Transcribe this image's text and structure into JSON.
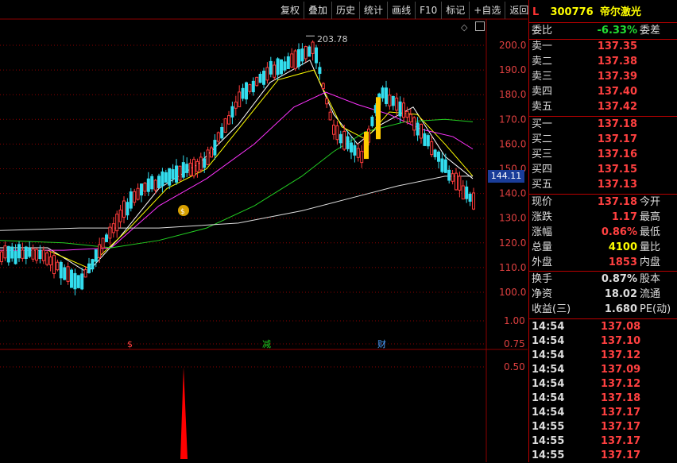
{
  "toolbar": [
    "复权",
    "叠加",
    "历史",
    "统计",
    "画线",
    "F10",
    "标记",
    "+自选",
    "返回"
  ],
  "header": {
    "level": "L",
    "code": "300776",
    "name": "帝尔激光"
  },
  "weibi": {
    "label": "委比",
    "value": "-6.33%",
    "label2": "委差"
  },
  "sell": [
    {
      "label": "卖五",
      "price": "137.42"
    },
    {
      "label": "卖四",
      "price": "137.40"
    },
    {
      "label": "卖三",
      "price": "137.39"
    },
    {
      "label": "卖二",
      "price": "137.38"
    },
    {
      "label": "卖一",
      "price": "137.35"
    }
  ],
  "buy": [
    {
      "label": "买一",
      "price": "137.18"
    },
    {
      "label": "买二",
      "price": "137.17"
    },
    {
      "label": "买三",
      "price": "137.16"
    },
    {
      "label": "买四",
      "price": "137.15"
    },
    {
      "label": "买五",
      "price": "137.13"
    }
  ],
  "quote": [
    {
      "label": "现价",
      "value": "137.18",
      "label2": "今开"
    },
    {
      "label": "涨跌",
      "value": "1.17",
      "label2": "最高"
    },
    {
      "label": "涨幅",
      "value": "0.86%",
      "label2": "最低"
    },
    {
      "label": "总量",
      "value": "4100",
      "label2": "量比"
    },
    {
      "label": "外盘",
      "value": "1853",
      "label2": "内盘"
    }
  ],
  "fund": [
    {
      "label": "换手",
      "value": "0.87%",
      "label2": "股本"
    },
    {
      "label": "净资",
      "value": "18.02",
      "label2": "流通"
    },
    {
      "label": "收益(三)",
      "value": "1.680",
      "label2": "PE(动)"
    }
  ],
  "ticks": [
    {
      "time": "14:54",
      "price": "137.08"
    },
    {
      "time": "14:54",
      "price": "137.10"
    },
    {
      "time": "14:54",
      "price": "137.12"
    },
    {
      "time": "14:54",
      "price": "137.09"
    },
    {
      "time": "14:54",
      "price": "137.12"
    },
    {
      "time": "14:54",
      "price": "137.18"
    },
    {
      "time": "14:54",
      "price": "137.17"
    },
    {
      "time": "14:55",
      "price": "137.17"
    },
    {
      "time": "14:55",
      "price": "137.17"
    },
    {
      "time": "14:55",
      "price": "137.17"
    }
  ],
  "price_axis": [
    "200.0",
    "190.0",
    "180.0",
    "170.0",
    "160.0",
    "150.0",
    "140.0",
    "130.0",
    "120.0",
    "110.0",
    "100.0"
  ],
  "sub_axis": [
    "1.00",
    "0.75",
    "0.50"
  ],
  "current_price_tag": "144.11",
  "high_label": "203.78",
  "markers": [
    "$",
    "减",
    "财"
  ],
  "colors": {
    "up": "#ff3b3b",
    "down": "#33ddee",
    "ma5": "#ffffff",
    "ma10": "#ffff00",
    "ma20": "#ff33ff",
    "ma60": "#22cc22",
    "ma250": "#dddddd",
    "signal": "#ff0000"
  }
}
